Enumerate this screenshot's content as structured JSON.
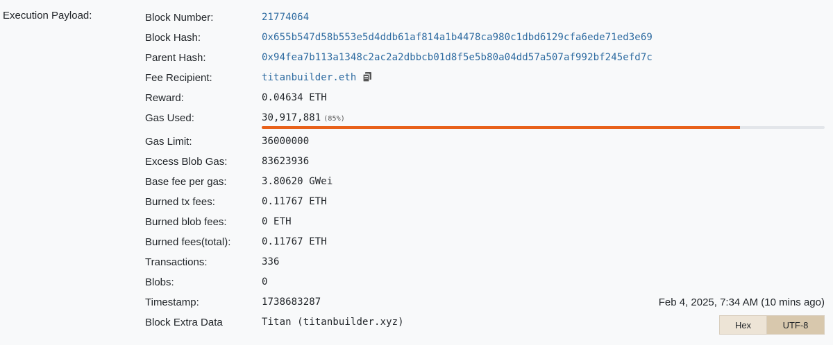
{
  "section_label": "Execution Payload:",
  "block_number": {
    "label": "Block Number:",
    "value": "21774064"
  },
  "block_hash": {
    "label": "Block Hash:",
    "value": "0x655b547d58b553e5d4ddb61af814a1b4478ca980c1dbd6129cfa6ede71ed3e69"
  },
  "parent_hash": {
    "label": "Parent Hash:",
    "value": "0x94fea7b113a1348c2ac2a2dbbcb01d8f5e5b80a04dd57a507af992bf245efd7c"
  },
  "fee_recipient": {
    "label": "Fee Recipient:",
    "value": "titanbuilder.eth",
    "icon": "copy-icon"
  },
  "reward": {
    "label": "Reward:",
    "value": "0.04634 ETH"
  },
  "gas_used": {
    "label": "Gas Used:",
    "value": "30,917,881",
    "percent_text": "(85%)",
    "fill_fraction": 0.85,
    "fill_color": "#e8611a"
  },
  "gas_limit": {
    "label": "Gas Limit:",
    "value": "36000000"
  },
  "excess_blob_gas": {
    "label": "Excess Blob Gas:",
    "value": "83623936"
  },
  "base_fee": {
    "label": "Base fee per gas:",
    "value": "3.80620 GWei"
  },
  "burned_tx_fees": {
    "label": "Burned tx fees:",
    "value": "0.11767 ETH"
  },
  "burned_blob_fees": {
    "label": "Burned blob fees:",
    "value": "0 ETH"
  },
  "burned_fees_total": {
    "label": "Burned fees(total):",
    "value": "0.11767 ETH"
  },
  "transactions": {
    "label": "Transactions:",
    "value": "336"
  },
  "blobs": {
    "label": "Blobs:",
    "value": "0"
  },
  "timestamp": {
    "label": "Timestamp:",
    "value": "1738683287",
    "human": "Feb 4, 2025, 7:34 AM (10 mins ago)"
  },
  "block_extra_data": {
    "label": "Block Extra Data",
    "value": "Titan (titanbuilder.xyz)",
    "encoding_options": [
      "Hex",
      "UTF-8"
    ],
    "selected_encoding": "UTF-8"
  }
}
